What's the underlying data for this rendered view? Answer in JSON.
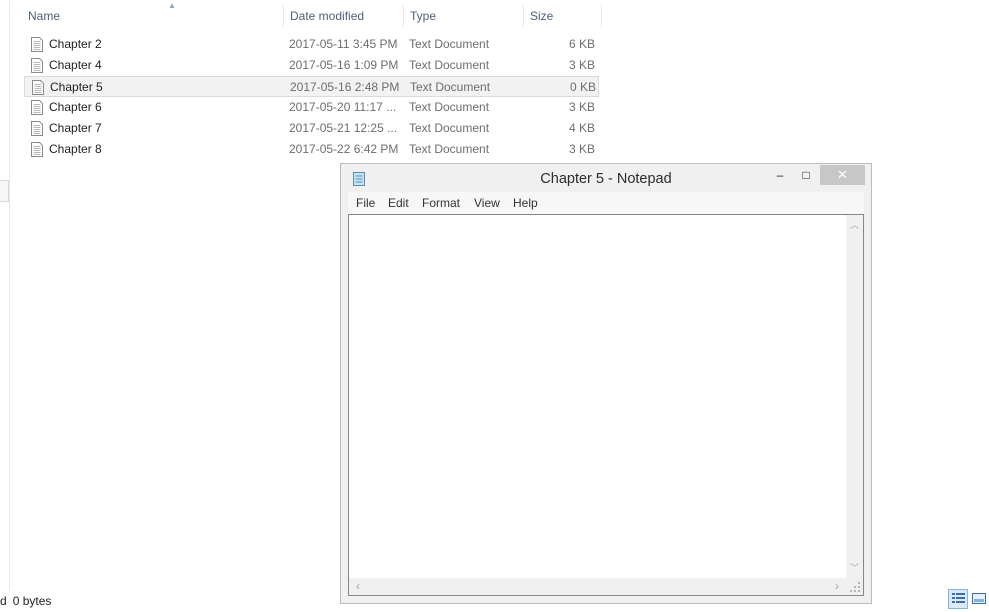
{
  "explorer": {
    "columns": {
      "name": "Name",
      "date": "Date modified",
      "type": "Type",
      "size": "Size"
    },
    "sort_column": "Name",
    "sort_direction": "ascending",
    "files": [
      {
        "name": "Chapter 2",
        "date": "2017-05-11 3:45 PM",
        "type": "Text Document",
        "size": "6 KB",
        "selected": false
      },
      {
        "name": "Chapter 4",
        "date": "2017-05-16 1:09 PM",
        "type": "Text Document",
        "size": "3 KB",
        "selected": false
      },
      {
        "name": "Chapter 5",
        "date": "2017-05-16 2:48 PM",
        "type": "Text Document",
        "size": "0 KB",
        "selected": true
      },
      {
        "name": "Chapter 6",
        "date": "2017-05-20 11:17 ...",
        "type": "Text Document",
        "size": "3 KB",
        "selected": false
      },
      {
        "name": "Chapter 7",
        "date": "2017-05-21 12:25 ...",
        "type": "Text Document",
        "size": "4 KB",
        "selected": false
      },
      {
        "name": "Chapter 8",
        "date": "2017-05-22 6:42 PM",
        "type": "Text Document",
        "size": "3 KB",
        "selected": false
      }
    ],
    "status": {
      "selected_fragment": "d",
      "size_text": "0 bytes"
    },
    "view_buttons": [
      "details-view-icon",
      "large-icons-view-icon"
    ],
    "active_view": "details"
  },
  "notepad": {
    "title": "Chapter 5 - Notepad",
    "menu": [
      "File",
      "Edit",
      "Format",
      "View",
      "Help"
    ],
    "content": "",
    "icons": {
      "app": "notepad-icon",
      "minimize": "minimize-icon",
      "maximize": "maximize-icon",
      "close": "close-icon"
    },
    "controls": {
      "minimize": "–",
      "maximize": "□",
      "close": "✕"
    }
  },
  "colors": {
    "header_text": "#4c607a",
    "meta_text": "#6d6d6d",
    "selected_row_bg": "#f2f2f2",
    "close_button_bg": "#c7c7c7",
    "active_view_bg": "#dceaf8"
  }
}
